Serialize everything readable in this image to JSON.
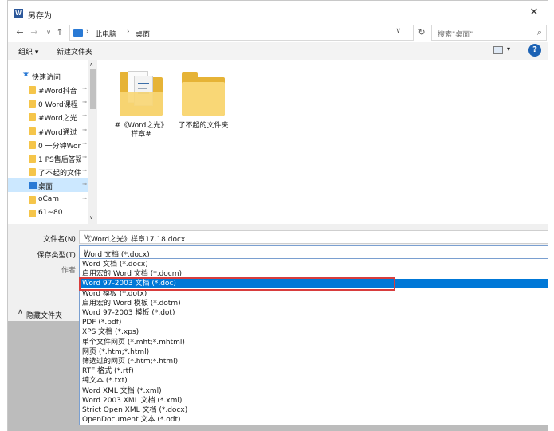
{
  "window": {
    "app_icon": "W",
    "title": "另存为",
    "close": "✕"
  },
  "nav": {
    "back": "←",
    "forward": "→",
    "recent": "∨",
    "up": "↑",
    "breadcrumb": [
      "此电脑",
      "桌面"
    ],
    "separator": "›",
    "address_dropdown": "∨",
    "refresh": "↻",
    "search_placeholder": "搜索\"桌面\"",
    "search_icon": "⌕"
  },
  "toolbar": {
    "organize": "组织 ▾",
    "new_folder": "新建文件夹",
    "view_dropdown": "▾",
    "help": "?"
  },
  "nav_pane": {
    "quick_access": "快速访问",
    "items": [
      {
        "label": "#Word抖音",
        "pinned": true,
        "type": "folder"
      },
      {
        "label": "0 Word课程",
        "pinned": true,
        "type": "folder"
      },
      {
        "label": "#Word之光",
        "pinned": true,
        "type": "folder"
      },
      {
        "label": "#Word通过",
        "pinned": true,
        "type": "folder"
      },
      {
        "label": "0 一分钟Wor",
        "pinned": true,
        "type": "folder"
      },
      {
        "label": "1 PS售后答疑",
        "pinned": true,
        "type": "folder"
      },
      {
        "label": "了不起的文件",
        "pinned": true,
        "type": "folder"
      },
      {
        "label": "桌面",
        "pinned": true,
        "type": "desktop",
        "selected": true
      },
      {
        "label": "oCam",
        "pinned": true,
        "type": "folder"
      },
      {
        "label": "61~80",
        "pinned": false,
        "type": "folder"
      }
    ],
    "pin_icon": "📌",
    "scroll_up": "∧",
    "scroll_down": "∨"
  },
  "files": [
    {
      "name": "#《Word之光》样章#",
      "line1": "#《Word之光》",
      "line2": "样章#",
      "kind": "folder-with-docs"
    },
    {
      "name": "了不起的文件夹",
      "line1": "了不起的文件夹",
      "line2": "",
      "kind": "folder"
    }
  ],
  "form": {
    "filename_label": "文件名(N):",
    "filename_value": "《Word之光》样章17.18.docx",
    "savetype_label": "保存类型(T):",
    "savetype_value": "Word 文档 (*.docx)",
    "author_label": "作者:",
    "hide_folders": "隐藏文件夹",
    "dropdown_arrow": "∨",
    "chevron_up": "∧"
  },
  "save_types": [
    "Word 文档 (*.docx)",
    "启用宏的 Word 文档 (*.docm)",
    "Word 97-2003 文档 (*.doc)",
    "Word 模板 (*.dotx)",
    "启用宏的 Word 模板 (*.dotm)",
    "Word 97-2003 模板 (*.dot)",
    "PDF (*.pdf)",
    "XPS 文档 (*.xps)",
    "单个文件网页 (*.mht;*.mhtml)",
    "网页 (*.htm;*.html)",
    "筛选过的网页 (*.htm;*.html)",
    "RTF 格式 (*.rtf)",
    "纯文本 (*.txt)",
    "Word XML 文档 (*.xml)",
    "Word 2003 XML 文档 (*.xml)",
    "Strict Open XML 文档 (*.docx)",
    "OpenDocument 文本 (*.odt)"
  ],
  "selected_type_index": 2,
  "colors": {
    "accent": "#0078d7",
    "highlight_box": "#d83d3d",
    "folder": "#f5c54a"
  }
}
